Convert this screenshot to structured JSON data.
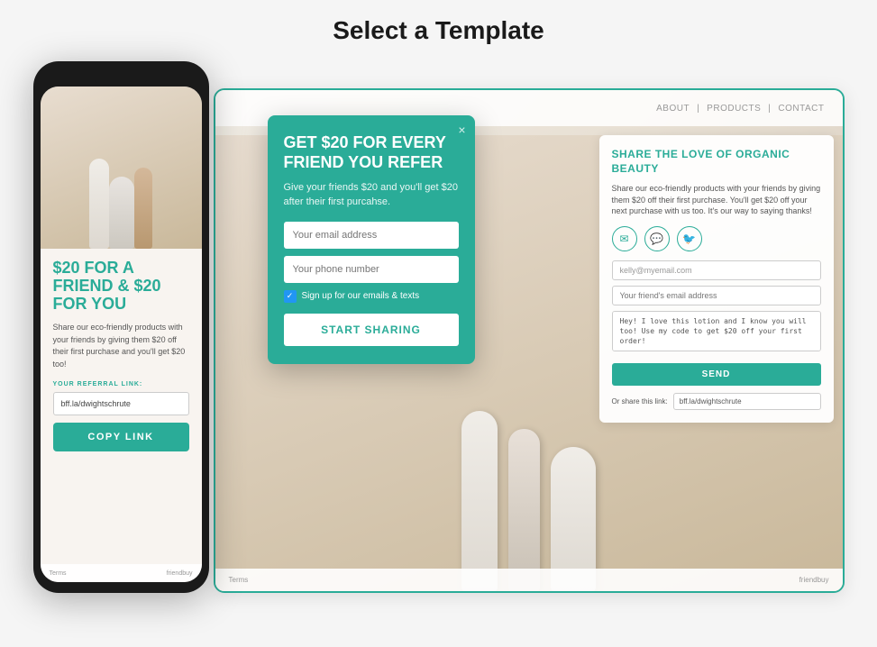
{
  "page": {
    "title": "Select a Template"
  },
  "modal": {
    "title": "GET $20 FOR EVERY FRIEND YOU REFER",
    "subtitle": "Give your friends $20 and you'll get $20 after their first purcahse.",
    "email_placeholder": "Your email address",
    "phone_placeholder": "Your phone number",
    "checkbox_label": "Sign up for our emails & texts",
    "cta_label": "START SHARING",
    "close_symbol": "×"
  },
  "desktop": {
    "nav": {
      "about": "ABOUT",
      "sep1": "|",
      "products": "PRODUCTS",
      "sep2": "|",
      "contact": "CONTACT"
    },
    "panel": {
      "title": "SHARE THE LOVE OF ORGANIC BEAUTY",
      "description": "Share our eco-friendly products with your friends by giving them $20 off their first purchase. You'll get $20 off your next purchase with us too. It's our way to saying thanks!",
      "email_value": "kelly@myemail.com",
      "friend_email_placeholder": "Your friend's email address",
      "message": "Hey! I love this lotion and I know you will too! Use my code to get $20 off your first order!",
      "send_label": "SEND",
      "share_link_label": "Or share this link:",
      "share_link_value": "bff.la/dwightschrute"
    },
    "footer": {
      "terms": "Terms",
      "brand": "friendbuy"
    }
  },
  "phone": {
    "headline": "$20 FOR A FRIEND & $20 FOR YOU",
    "body": "Share our eco-friendly products with your friends by giving them $20 off their first purchase and you'll get $20 too!",
    "referral_label": "YOUR REFERRAL LINK:",
    "link_value": "bff.la/dwightschrute",
    "copy_btn": "COPY LINK",
    "footer": {
      "terms": "Terms",
      "brand": "friendbuy"
    }
  },
  "icons": {
    "email": "✉",
    "chat": "💬",
    "twitter": "🐦"
  }
}
